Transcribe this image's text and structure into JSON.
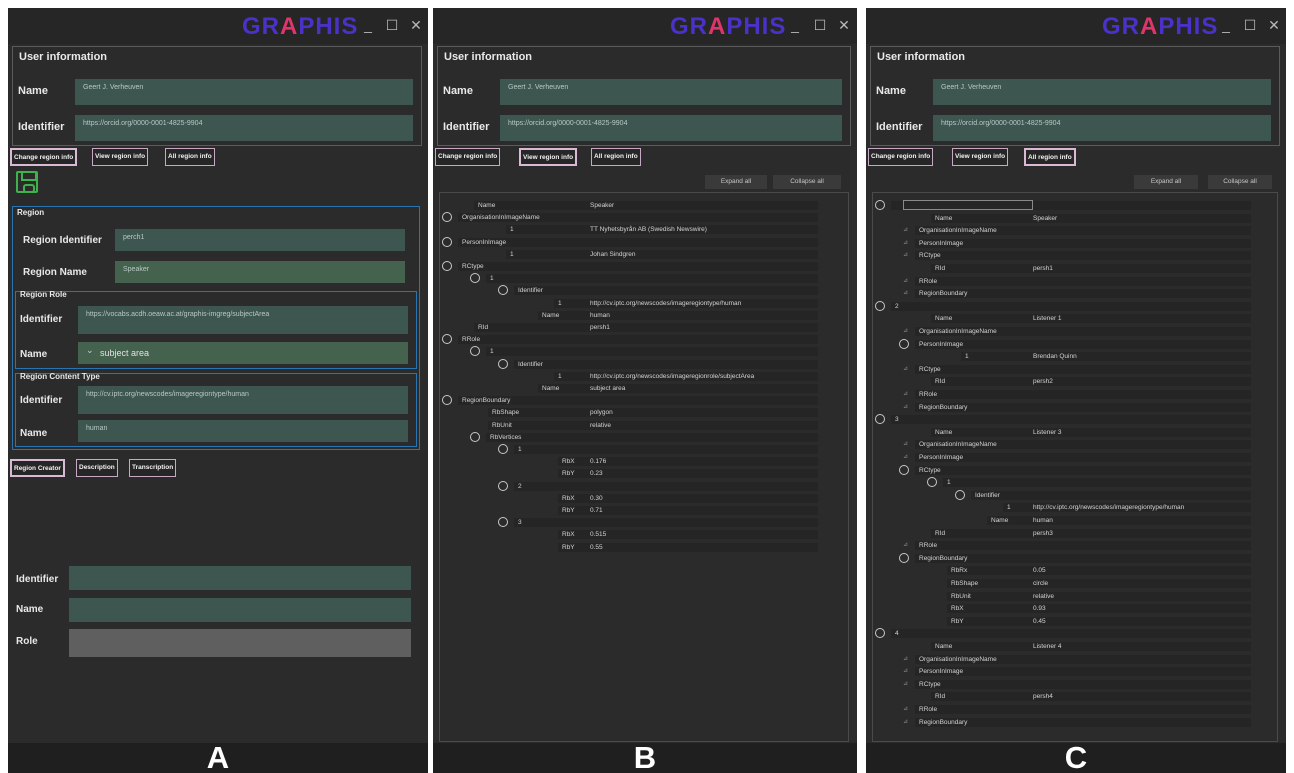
{
  "app": {
    "logo": "GR",
    "logo_mid": "A",
    "logo_end": "PHIS",
    "minimize": "_",
    "maximize": "☐",
    "close": "✕"
  },
  "user": {
    "header": "User information",
    "name_label": "Name",
    "name_value": "Geert J. Verheuven",
    "identifier_label": "Identifier",
    "identifier_value": "https://orcid.org/0000-0001-4825-9904"
  },
  "tabs": {
    "change": "Change region info",
    "view": "View region info",
    "all": "All region info"
  },
  "panel_a": {
    "region_header": "Region",
    "region_identifier_label": "Region Identifier",
    "region_identifier_value": "perch1",
    "region_name_label": "Region Name",
    "region_name_value": "Speaker",
    "role_header": "Region Role",
    "role_identifier_label": "Identifier",
    "role_identifier_value": "https://vocabs.acdh.oeaw.ac.at/graphis-imgreg/subjectArea",
    "role_name_label": "Name",
    "role_name_value": "subject area",
    "content_header": "Region Content Type",
    "content_identifier_label": "Identifier",
    "content_identifier_value": "http://cv.iptc.org/newscodes/imageregiontype/human",
    "content_name_label": "Name",
    "content_name_value": "human",
    "subtabs": [
      "Region Creator",
      "Description",
      "Transcription"
    ],
    "creator_identifier_label": "Identifier",
    "creator_name_label": "Name",
    "creator_role_label": "Role",
    "caption": "A"
  },
  "panel_b": {
    "expand": "Expand all",
    "collapse": "Collapse all",
    "rows": [
      {
        "k": "Name",
        "v": "Speaker"
      },
      {
        "k": "OrganisationInImageName",
        "v": ""
      },
      {
        "k": "1",
        "v": "TT Nyhetsbyrån AB (Swedish Newswire)"
      },
      {
        "k": "PersonInImage",
        "v": ""
      },
      {
        "k": "1",
        "v": "Johan Sindgren"
      },
      {
        "k": "RCtype",
        "v": ""
      },
      {
        "k": "1",
        "v": ""
      },
      {
        "k": "Identifier",
        "v": ""
      },
      {
        "k": "1",
        "v": "http://cv.iptc.org/newscodes/imageregiontype/human"
      },
      {
        "k": "Name",
        "v": "human"
      },
      {
        "k": "RId",
        "v": "persh1"
      },
      {
        "k": "RRole",
        "v": ""
      },
      {
        "k": "1",
        "v": ""
      },
      {
        "k": "Identifier",
        "v": ""
      },
      {
        "k": "1",
        "v": "http://cv.iptc.org/newscodes/imageregionrole/subjectArea"
      },
      {
        "k": "Name",
        "v": "subject area"
      },
      {
        "k": "RegionBoundary",
        "v": ""
      },
      {
        "k": "RbShape",
        "v": "polygon"
      },
      {
        "k": "RbUnit",
        "v": "relative"
      },
      {
        "k": "RbVertices",
        "v": ""
      },
      {
        "k": "1",
        "v": ""
      },
      {
        "k": "RbX",
        "v": "0.176"
      },
      {
        "k": "RbY",
        "v": "0.23"
      },
      {
        "k": "2",
        "v": ""
      },
      {
        "k": "RbX",
        "v": "0.30"
      },
      {
        "k": "RbY",
        "v": "0.71"
      },
      {
        "k": "3",
        "v": ""
      },
      {
        "k": "RbX",
        "v": "0.515"
      },
      {
        "k": "RbY",
        "v": "0.55"
      }
    ],
    "caption": "B"
  },
  "panel_c": {
    "expand": "Expand all",
    "collapse": "Collapse all",
    "rows": [
      {
        "k": "",
        "v": ""
      },
      {
        "k": "Name",
        "v": "Speaker"
      },
      {
        "k": "OrganisationInImageName",
        "v": ""
      },
      {
        "k": "PersonInImage",
        "v": ""
      },
      {
        "k": "RCtype",
        "v": ""
      },
      {
        "k": "RId",
        "v": "persh1"
      },
      {
        "k": "RRole",
        "v": ""
      },
      {
        "k": "RegionBoundary",
        "v": ""
      },
      {
        "k": "2",
        "v": ""
      },
      {
        "k": "Name",
        "v": "Listener 1"
      },
      {
        "k": "OrganisationInImageName",
        "v": ""
      },
      {
        "k": "PersonInImage",
        "v": ""
      },
      {
        "k": "1",
        "v": "Brendan Quinn"
      },
      {
        "k": "RCtype",
        "v": ""
      },
      {
        "k": "RId",
        "v": "persh2"
      },
      {
        "k": "RRole",
        "v": ""
      },
      {
        "k": "RegionBoundary",
        "v": ""
      },
      {
        "k": "3",
        "v": ""
      },
      {
        "k": "Name",
        "v": "Listener 3"
      },
      {
        "k": "OrganisationInImageName",
        "v": ""
      },
      {
        "k": "PersonInImage",
        "v": ""
      },
      {
        "k": "RCtype",
        "v": ""
      },
      {
        "k": "1",
        "v": ""
      },
      {
        "k": "Identifier",
        "v": ""
      },
      {
        "k": "1",
        "v": "http://cv.iptc.org/newscodes/imageregiontype/human"
      },
      {
        "k": "Name",
        "v": "human"
      },
      {
        "k": "RId",
        "v": "persh3"
      },
      {
        "k": "RRole",
        "v": ""
      },
      {
        "k": "RegionBoundary",
        "v": ""
      },
      {
        "k": "RbRx",
        "v": "0.05"
      },
      {
        "k": "RbShape",
        "v": "circle"
      },
      {
        "k": "RbUnit",
        "v": "relative"
      },
      {
        "k": "RbX",
        "v": "0.93"
      },
      {
        "k": "RbY",
        "v": "0.45"
      },
      {
        "k": "4",
        "v": ""
      },
      {
        "k": "Name",
        "v": "Listener 4"
      },
      {
        "k": "OrganisationInImageName",
        "v": ""
      },
      {
        "k": "PersonInImage",
        "v": ""
      },
      {
        "k": "RCtype",
        "v": ""
      },
      {
        "k": "RId",
        "v": "persh4"
      },
      {
        "k": "RRole",
        "v": ""
      },
      {
        "k": "RegionBoundary",
        "v": ""
      }
    ],
    "caption": "C"
  }
}
